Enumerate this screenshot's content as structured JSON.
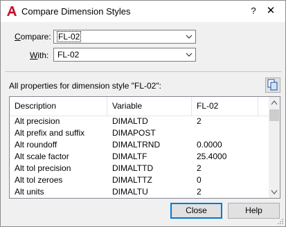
{
  "window": {
    "title": "Compare Dimension Styles",
    "help_glyph": "?",
    "close_glyph": "✕"
  },
  "compare": {
    "label_prefix": "",
    "label_access": "C",
    "label_rest": "ompare:",
    "value": "FL-02"
  },
  "with": {
    "label_prefix": "",
    "label_access": "W",
    "label_rest": "ith:",
    "value": "FL-02"
  },
  "properties_label": "All properties for dimension style \"FL-02\":",
  "columns": [
    "Description",
    "Variable",
    "FL-02"
  ],
  "rows": [
    {
      "description": "Alt precision",
      "variable": "DIMALTD",
      "value": "2"
    },
    {
      "description": "Alt prefix and suffix",
      "variable": "DIMAPOST",
      "value": ""
    },
    {
      "description": "Alt roundoff",
      "variable": "DIMALTRND",
      "value": "0.0000"
    },
    {
      "description": "Alt scale factor",
      "variable": "DIMALTF",
      "value": "25.4000"
    },
    {
      "description": "Alt tol precision",
      "variable": "DIMALTTD",
      "value": "2"
    },
    {
      "description": "Alt tol zeroes",
      "variable": "DIMALTTZ",
      "value": "0"
    },
    {
      "description": "Alt units",
      "variable": "DIMALTU",
      "value": "2"
    }
  ],
  "buttons": {
    "close": "Close",
    "help": "Help"
  },
  "colors": {
    "accent": "#0078d7",
    "app_icon": "#c8102e"
  }
}
